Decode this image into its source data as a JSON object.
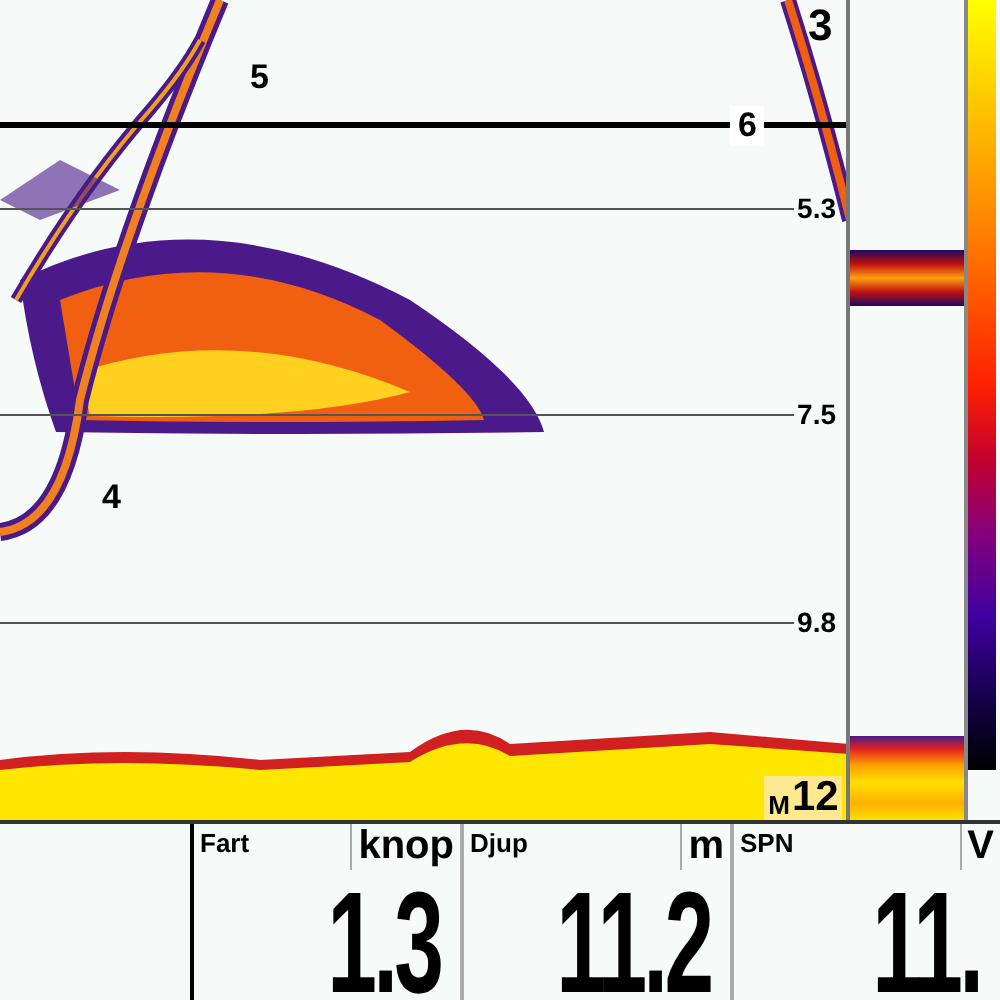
{
  "sonar": {
    "markers": [
      {
        "label": "3"
      },
      {
        "label": "5"
      },
      {
        "label": "4"
      }
    ],
    "cursor": {
      "label": "6"
    },
    "depth_lines": [
      {
        "label": "5.3"
      },
      {
        "label": "7.5"
      },
      {
        "label": "9.8"
      }
    ],
    "range": {
      "unit": "M",
      "value": "12"
    }
  },
  "readouts": [
    {
      "label": "Fart",
      "unit": "knop",
      "value": "1.3"
    },
    {
      "label": "Djup",
      "unit": "m",
      "value": "11.2"
    },
    {
      "label": "SPN",
      "unit": "V",
      "value": "11."
    }
  ]
}
